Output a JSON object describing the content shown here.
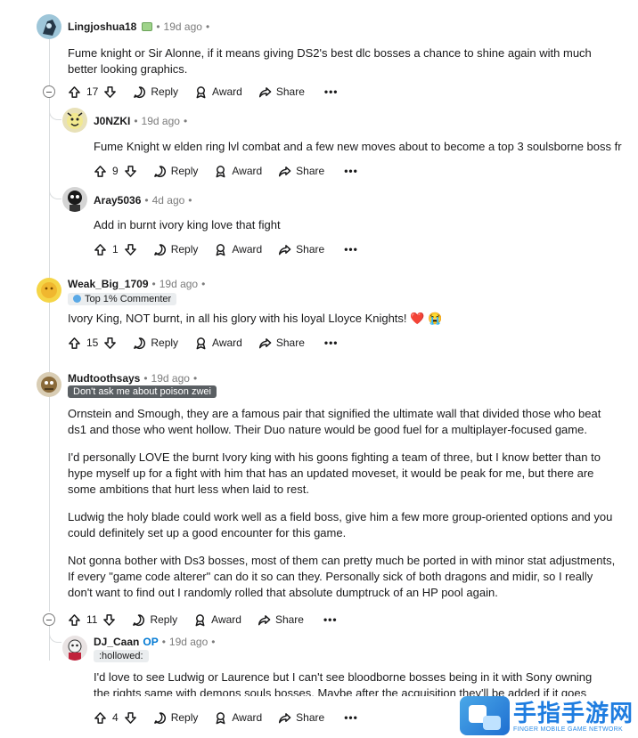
{
  "comments": [
    {
      "username": "Lingjoshua18",
      "time": "19d ago",
      "body": [
        "Fume knight or Sir Alonne, if it means giving DS2's best dlc bosses a chance to shine again with much better looking graphics."
      ],
      "score": "17",
      "reply": "Reply",
      "award": "Award",
      "share": "Share"
    },
    {
      "username": "J0NZKI",
      "time": "19d ago",
      "body": [
        "Fume Knight w elden ring lvl combat and a few new moves about to become a top 3 soulsborne boss fr"
      ],
      "score": "9",
      "reply": "Reply",
      "award": "Award",
      "share": "Share"
    },
    {
      "username": "Aray5036",
      "time": "4d ago",
      "body": [
        "Add in burnt ivory king love that fight"
      ],
      "score": "1",
      "reply": "Reply",
      "award": "Award",
      "share": "Share"
    },
    {
      "username": "Weak_Big_1709",
      "time": "19d ago",
      "flair": "Top 1% Commenter",
      "body": [
        "Ivory King, NOT burnt, in all his glory with his loyal Lloyce Knights! ❤️ 😭"
      ],
      "score": "15",
      "reply": "Reply",
      "award": "Award",
      "share": "Share"
    },
    {
      "username": "Mudtoothsays",
      "time": "19d ago",
      "flair": "Don't ask me about poison zwei",
      "body": [
        "Ornstein and Smough, they are a famous pair that signified the ultimate wall that divided those who beat ds1 and those who went hollow. Their Duo nature would be good fuel for a multiplayer-focused game.",
        "I'd personally LOVE the burnt Ivory king with his goons fighting a team of three, but I know better than to hype myself up for a fight with him that has an updated moveset, it would be peak for me, but there are some ambitions that hurt less when laid to rest.",
        "Ludwig the holy blade could work well as a field boss, give him a few more group-oriented options and you could definitely set up a good encounter for this game.",
        "Not gonna bother with Ds3 bosses, most of them can pretty much be ported in with minor stat adjustments, If every \"game code alterer\" can do it so can they. Personally sick of both dragons and midir, so I really don't want to find out I randomly rolled that absolute dumptruck of an HP pool again."
      ],
      "score": "11",
      "reply": "Reply",
      "award": "Award",
      "share": "Share"
    },
    {
      "username": "DJ_Caan",
      "op": "OP",
      "time": "19d ago",
      "flair": ":hollowed:",
      "body": [
        "I'd love to see Ludwig or Laurence but I can't see bloodborne bosses being in it with Sony owning the rights same with demons souls bosses. Maybe after the acquisition they'll be added if it goes ahead"
      ],
      "score": "4",
      "reply": "Reply",
      "award": "Award",
      "share": "Share"
    }
  ],
  "watermark": {
    "cn": "手指手游网",
    "en": "FINGER MOBILE GAME NETWORK"
  },
  "colors": {
    "accent": "#0079d3",
    "meta": "#7c7c7c",
    "thread": "#d9dcde"
  }
}
